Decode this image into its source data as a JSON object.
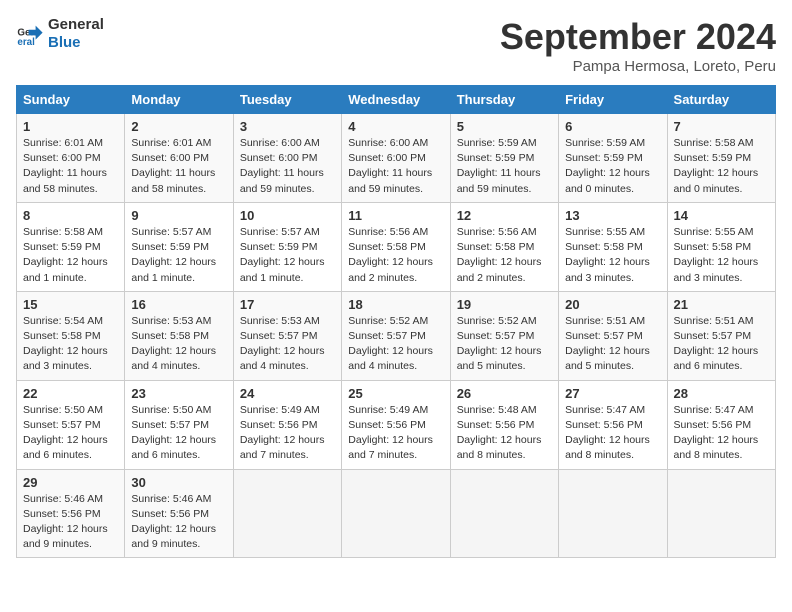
{
  "logo": {
    "line1": "General",
    "line2": "Blue"
  },
  "title": "September 2024",
  "subtitle": "Pampa Hermosa, Loreto, Peru",
  "days_of_week": [
    "Sunday",
    "Monday",
    "Tuesday",
    "Wednesday",
    "Thursday",
    "Friday",
    "Saturday"
  ],
  "weeks": [
    [
      {
        "day": "1",
        "sunrise": "6:01 AM",
        "sunset": "6:00 PM",
        "daylight": "11 hours and 58 minutes."
      },
      {
        "day": "2",
        "sunrise": "6:01 AM",
        "sunset": "6:00 PM",
        "daylight": "11 hours and 58 minutes."
      },
      {
        "day": "3",
        "sunrise": "6:00 AM",
        "sunset": "6:00 PM",
        "daylight": "11 hours and 59 minutes."
      },
      {
        "day": "4",
        "sunrise": "6:00 AM",
        "sunset": "6:00 PM",
        "daylight": "11 hours and 59 minutes."
      },
      {
        "day": "5",
        "sunrise": "5:59 AM",
        "sunset": "5:59 PM",
        "daylight": "11 hours and 59 minutes."
      },
      {
        "day": "6",
        "sunrise": "5:59 AM",
        "sunset": "5:59 PM",
        "daylight": "12 hours and 0 minutes."
      },
      {
        "day": "7",
        "sunrise": "5:58 AM",
        "sunset": "5:59 PM",
        "daylight": "12 hours and 0 minutes."
      }
    ],
    [
      {
        "day": "8",
        "sunrise": "5:58 AM",
        "sunset": "5:59 PM",
        "daylight": "12 hours and 1 minute."
      },
      {
        "day": "9",
        "sunrise": "5:57 AM",
        "sunset": "5:59 PM",
        "daylight": "12 hours and 1 minute."
      },
      {
        "day": "10",
        "sunrise": "5:57 AM",
        "sunset": "5:59 PM",
        "daylight": "12 hours and 1 minute."
      },
      {
        "day": "11",
        "sunrise": "5:56 AM",
        "sunset": "5:58 PM",
        "daylight": "12 hours and 2 minutes."
      },
      {
        "day": "12",
        "sunrise": "5:56 AM",
        "sunset": "5:58 PM",
        "daylight": "12 hours and 2 minutes."
      },
      {
        "day": "13",
        "sunrise": "5:55 AM",
        "sunset": "5:58 PM",
        "daylight": "12 hours and 3 minutes."
      },
      {
        "day": "14",
        "sunrise": "5:55 AM",
        "sunset": "5:58 PM",
        "daylight": "12 hours and 3 minutes."
      }
    ],
    [
      {
        "day": "15",
        "sunrise": "5:54 AM",
        "sunset": "5:58 PM",
        "daylight": "12 hours and 3 minutes."
      },
      {
        "day": "16",
        "sunrise": "5:53 AM",
        "sunset": "5:58 PM",
        "daylight": "12 hours and 4 minutes."
      },
      {
        "day": "17",
        "sunrise": "5:53 AM",
        "sunset": "5:57 PM",
        "daylight": "12 hours and 4 minutes."
      },
      {
        "day": "18",
        "sunrise": "5:52 AM",
        "sunset": "5:57 PM",
        "daylight": "12 hours and 4 minutes."
      },
      {
        "day": "19",
        "sunrise": "5:52 AM",
        "sunset": "5:57 PM",
        "daylight": "12 hours and 5 minutes."
      },
      {
        "day": "20",
        "sunrise": "5:51 AM",
        "sunset": "5:57 PM",
        "daylight": "12 hours and 5 minutes."
      },
      {
        "day": "21",
        "sunrise": "5:51 AM",
        "sunset": "5:57 PM",
        "daylight": "12 hours and 6 minutes."
      }
    ],
    [
      {
        "day": "22",
        "sunrise": "5:50 AM",
        "sunset": "5:57 PM",
        "daylight": "12 hours and 6 minutes."
      },
      {
        "day": "23",
        "sunrise": "5:50 AM",
        "sunset": "5:57 PM",
        "daylight": "12 hours and 6 minutes."
      },
      {
        "day": "24",
        "sunrise": "5:49 AM",
        "sunset": "5:56 PM",
        "daylight": "12 hours and 7 minutes."
      },
      {
        "day": "25",
        "sunrise": "5:49 AM",
        "sunset": "5:56 PM",
        "daylight": "12 hours and 7 minutes."
      },
      {
        "day": "26",
        "sunrise": "5:48 AM",
        "sunset": "5:56 PM",
        "daylight": "12 hours and 8 minutes."
      },
      {
        "day": "27",
        "sunrise": "5:47 AM",
        "sunset": "5:56 PM",
        "daylight": "12 hours and 8 minutes."
      },
      {
        "day": "28",
        "sunrise": "5:47 AM",
        "sunset": "5:56 PM",
        "daylight": "12 hours and 8 minutes."
      }
    ],
    [
      {
        "day": "29",
        "sunrise": "5:46 AM",
        "sunset": "5:56 PM",
        "daylight": "12 hours and 9 minutes."
      },
      {
        "day": "30",
        "sunrise": "5:46 AM",
        "sunset": "5:56 PM",
        "daylight": "12 hours and 9 minutes."
      },
      null,
      null,
      null,
      null,
      null
    ]
  ]
}
